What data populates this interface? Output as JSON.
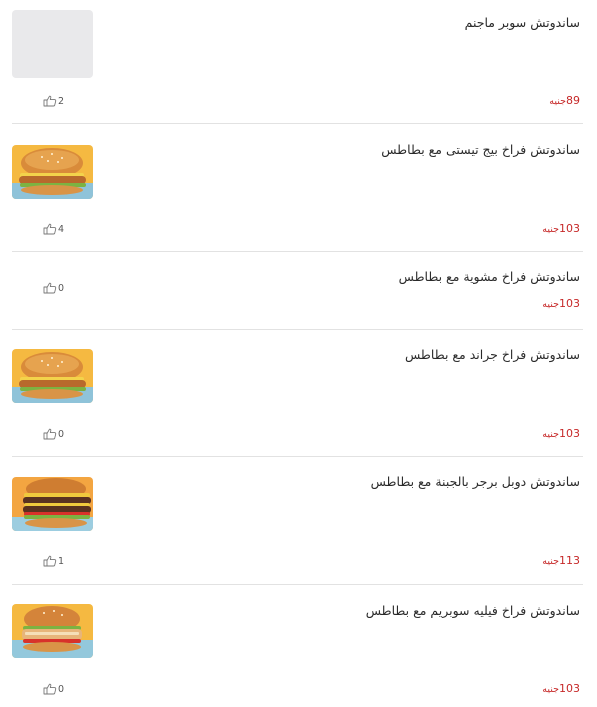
{
  "currency": "جنيه",
  "items": [
    {
      "title": "ساندوتش سوبر ماجنم",
      "price": "89",
      "likes": "2",
      "image": "placeholder-image"
    },
    {
      "title": "ساندوتش فراخ بيج تيستى مع بطاطس",
      "price": "103",
      "likes": "4",
      "image": "chicken-burger-image"
    },
    {
      "title": "ساندوتش فراخ مشوية مع بطاطس",
      "price": "103",
      "likes": "0",
      "image": ""
    },
    {
      "title": "ساندوتش فراخ جراند مع بطاطس",
      "price": "103",
      "likes": "0",
      "image": "chicken-burger-image"
    },
    {
      "title": "ساندوتش دوبل برجر بالجبنة مع بطاطس",
      "price": "113",
      "likes": "1",
      "image": "double-beef-burger-image"
    },
    {
      "title": "ساندوتش فراخ فيليه سوبريم مع بطاطس",
      "price": "103",
      "likes": "0",
      "image": "chicken-fillet-burger-image"
    }
  ]
}
